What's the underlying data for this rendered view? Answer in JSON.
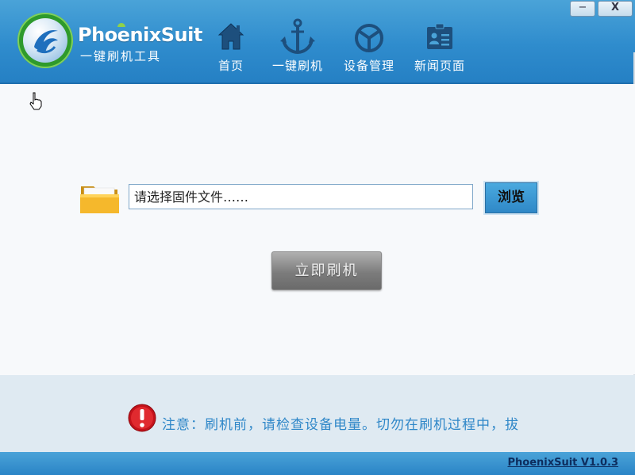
{
  "header": {
    "brand_name": "PhoenixSuit",
    "brand_subtitle": "一键刷机工具",
    "nav": [
      {
        "label": "首页",
        "icon": "home-icon"
      },
      {
        "label": "一键刷机",
        "icon": "anchor-icon"
      },
      {
        "label": "设备管理",
        "icon": "device-icon"
      },
      {
        "label": "新闻页面",
        "icon": "news-icon"
      }
    ],
    "window_controls": {
      "minimize": "−",
      "close": "X"
    }
  },
  "main": {
    "file_input_placeholder": "请选择固件文件……",
    "browse_label": "浏览",
    "flash_label": "立即刷机"
  },
  "notice": {
    "text": "注意：刷机前，请检查设备电量。切勿在刷机过程中，拔"
  },
  "footer": {
    "version": "PhoenixSuit V1.0.3"
  },
  "colors": {
    "header_blue": "#2f8ccd",
    "notice_text": "#2f87c8",
    "notice_band": "#dfeaf2",
    "flash_button": "#7c7c7c"
  }
}
